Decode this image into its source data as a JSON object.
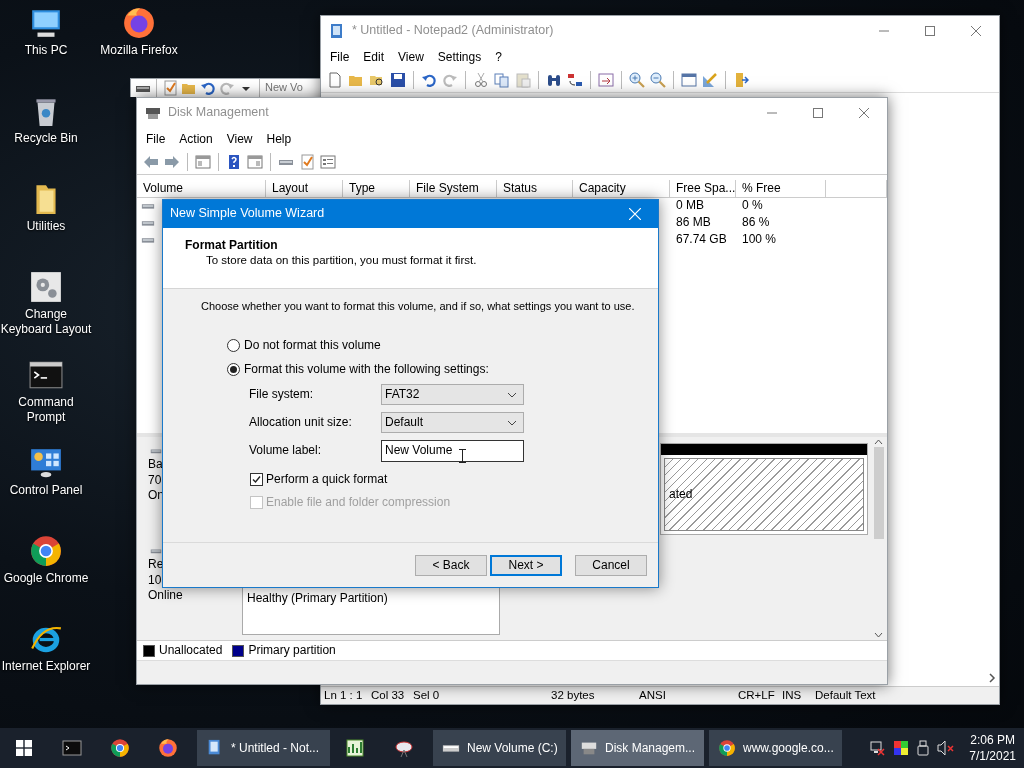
{
  "desktop_columns": [
    {
      "icons": [
        {
          "label": "This PC",
          "kind": "computer"
        },
        {
          "label": "Recycle Bin",
          "kind": "recycle"
        },
        {
          "label": "Utilities",
          "kind": "folder"
        },
        {
          "label": "Change Keyboard Layout",
          "kind": "gears"
        },
        {
          "label": "Command Prompt",
          "kind": "terminal"
        },
        {
          "label": "Control Panel",
          "kind": "control"
        },
        {
          "label": "Google Chrome",
          "kind": "chrome"
        },
        {
          "label": "Internet Explorer",
          "kind": "ie"
        }
      ]
    },
    {
      "icons": [
        {
          "label": "Mozilla Firefox",
          "kind": "firefox"
        }
      ]
    }
  ],
  "background_window": {
    "toolbar_text": "New Vo"
  },
  "notepad": {
    "title": "* Untitled - Notepad2 (Administrator)",
    "menu": [
      "File",
      "Edit",
      "View",
      "Settings",
      "?"
    ],
    "status_bar": [
      "Ln 1 : 1",
      "Col 33",
      "Sel 0",
      "32 bytes",
      "ANSI",
      "CR+LF",
      "INS",
      "Default Text"
    ]
  },
  "disk_management": {
    "title": "Disk Management",
    "menu": [
      "File",
      "Action",
      "View",
      "Help"
    ],
    "table": {
      "columns": [
        "Volume",
        "Layout",
        "Type",
        "File System",
        "Status",
        "Capacity",
        "Free Spa...",
        "% Free"
      ],
      "rows": [
        {
          "free_space": "0 MB",
          "percent_free": "0 %"
        },
        {
          "free_space": "86 MB",
          "percent_free": "86 %"
        },
        {
          "free_space": "67.74 GB",
          "percent_free": "100 %"
        }
      ]
    },
    "disks": [
      {
        "lines": [
          "Ba",
          "70",
          "On"
        ],
        "partition": {
          "kind": "unallocated",
          "text": "ated"
        }
      },
      {
        "lines": [
          "Re",
          "10",
          "Online"
        ],
        "partition": {
          "kind": "primary",
          "text": "Healthy (Primary Partition)"
        }
      }
    ],
    "legend": [
      {
        "label": "Unallocated",
        "color": "#000000"
      },
      {
        "label": "Primary partition",
        "color": "#00008b"
      }
    ]
  },
  "wizard": {
    "title": "New Simple Volume Wizard",
    "heading": "Format Partition",
    "subheading": "To store data on this partition, you must format it first.",
    "intro": "Choose whether you want to format this volume, and if so, what settings you want to use.",
    "radios": [
      {
        "label": "Do not format this volume",
        "selected": false
      },
      {
        "label": "Format this volume with the following settings:",
        "selected": true
      }
    ],
    "fields": [
      {
        "label": "File system:",
        "kind": "dropdown",
        "value": "FAT32"
      },
      {
        "label": "Allocation unit size:",
        "kind": "dropdown",
        "value": "Default"
      },
      {
        "label": "Volume label:",
        "kind": "text",
        "value": "New Volume"
      }
    ],
    "checkboxes": [
      {
        "label": "Perform a quick format",
        "checked": true,
        "disabled": false
      },
      {
        "label": "Enable file and folder compression",
        "checked": false,
        "disabled": true
      }
    ],
    "buttons": [
      {
        "label": "< Back",
        "default": false
      },
      {
        "label": "Next >",
        "default": true
      },
      {
        "label": "Cancel",
        "default": false
      }
    ]
  },
  "taskbar": {
    "items": [
      {
        "kind": "icon"
      },
      {
        "kind": "icon"
      },
      {
        "kind": "icon"
      },
      {
        "kind": "window",
        "label": "* Untitled - Not...",
        "selected": false
      },
      {
        "kind": "icon"
      },
      {
        "kind": "icon"
      },
      {
        "kind": "window",
        "label": "New Volume (C:)",
        "selected": false
      },
      {
        "kind": "window",
        "label": "Disk Managem...",
        "selected": true
      },
      {
        "kind": "window",
        "label": "www.google.co...",
        "selected": false
      }
    ],
    "time": "2:06 PM",
    "date": "7/1/2021"
  }
}
